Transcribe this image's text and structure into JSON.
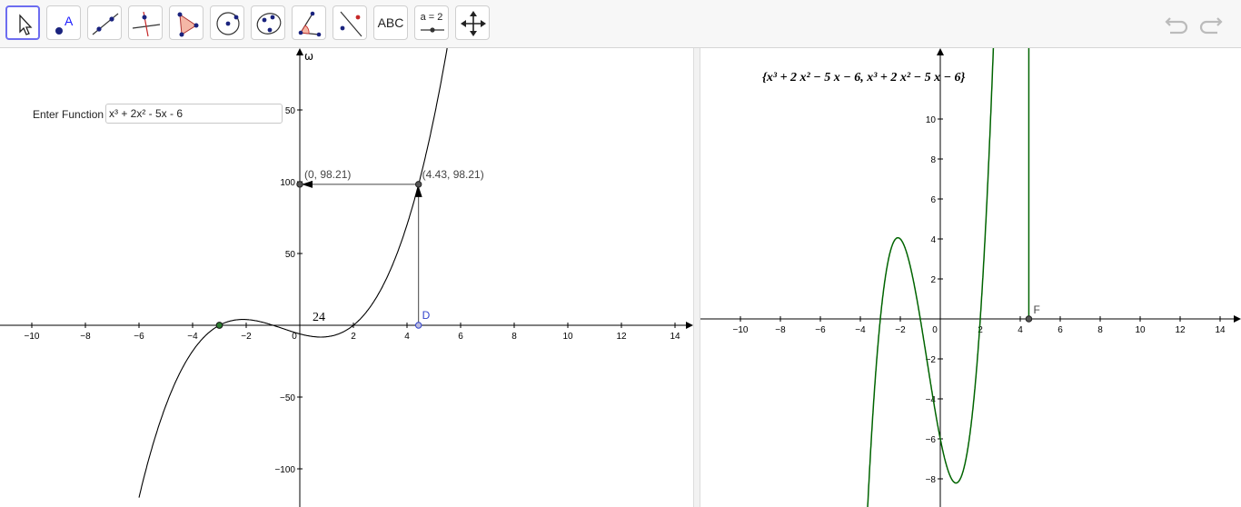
{
  "toolbar": {
    "tools": [
      {
        "name": "move-tool"
      },
      {
        "name": "point-tool"
      },
      {
        "name": "line-tool"
      },
      {
        "name": "perpendicular-line-tool"
      },
      {
        "name": "polygon-tool"
      },
      {
        "name": "circle-center-point-tool"
      },
      {
        "name": "conic-tool"
      },
      {
        "name": "angle-tool"
      },
      {
        "name": "reflect-tool"
      },
      {
        "name": "text-tool",
        "label": "ABC"
      },
      {
        "name": "slider-tool",
        "label": "a = 2"
      },
      {
        "name": "move-graphics-view-tool"
      }
    ],
    "undo_icon": "undo-icon",
    "redo_icon": "redo-icon"
  },
  "input": {
    "label": "Enter Function",
    "value": "x³ + 2x² - 5x - 6"
  },
  "left_graph": {
    "function": "x^3 + 2x^2 - 5x - 6",
    "y_axis_label": "ω",
    "x_ticks": [
      "−10",
      "−8",
      "−6",
      "−4",
      "−2",
      "0",
      "2",
      "4",
      "6",
      "8",
      "10",
      "12",
      "14"
    ],
    "y_ticks": [
      "50",
      "100",
      "50",
      "−50",
      "−100"
    ],
    "text_label": "24",
    "point_a_label": "(0, 98.21)",
    "point_b_label": "(4.43, 98.21)",
    "point_d_label": "D",
    "point_d_x": 4.43,
    "point_d_y": 98.21,
    "root_x": -3
  },
  "right_graph": {
    "formula_text": "{x³ + 2 x² − 5 x − 6, x³ + 2 x² − 5 x − 6}",
    "x_ticks": [
      "−10",
      "−8",
      "−6",
      "−4",
      "−2",
      "0",
      "2",
      "4",
      "6",
      "8",
      "10",
      "12",
      "14"
    ],
    "y_ticks": [
      "10",
      "8",
      "6",
      "4",
      "2",
      "−2",
      "−4",
      "−6",
      "−8"
    ],
    "point_f_label": "F",
    "point_f_x": 4.43,
    "curve_color": "#006400"
  }
}
